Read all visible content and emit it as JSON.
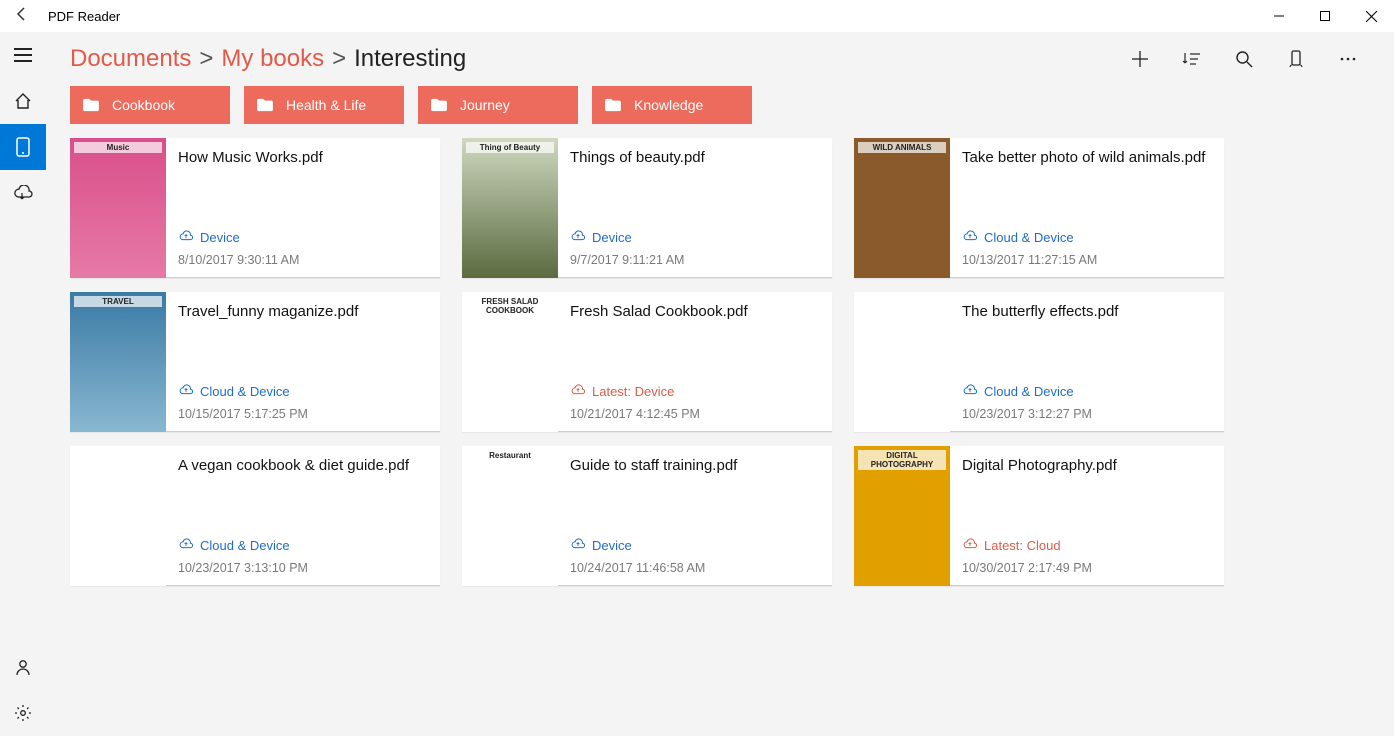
{
  "window": {
    "title": "PDF Reader"
  },
  "breadcrumb": {
    "root": "Documents",
    "mid": "My books",
    "current": "Interesting",
    "sep": ">"
  },
  "folders": [
    {
      "label": "Cookbook"
    },
    {
      "label": "Health & Life"
    },
    {
      "label": "Journey"
    },
    {
      "label": "Knowledge"
    }
  ],
  "storageLabels": {
    "device": "Device",
    "cloudDevice": "Cloud & Device",
    "latestDevice": "Latest: Device",
    "latestCloud": "Latest: Cloud"
  },
  "files": [
    {
      "name": "How Music Works.pdf",
      "storage": "device",
      "timestamp": "8/10/2017 9:30:11 AM",
      "thumbClass": "ph-music",
      "thumbTitle": "Music"
    },
    {
      "name": "Things of beauty.pdf",
      "storage": "device",
      "timestamp": "9/7/2017 9:11:21 AM",
      "thumbClass": "ph-beauty",
      "thumbTitle": "Thing of Beauty"
    },
    {
      "name": "Take better photo of wild animals.pdf",
      "storage": "cloudDevice",
      "timestamp": "10/13/2017 11:27:15 AM",
      "thumbClass": "ph-wild",
      "thumbTitle": "WILD ANIMALS"
    },
    {
      "name": "Travel_funny maganize.pdf",
      "storage": "cloudDevice",
      "timestamp": "10/15/2017 5:17:25 PM",
      "thumbClass": "ph-travel",
      "thumbTitle": "TRAVEL"
    },
    {
      "name": "Fresh Salad Cookbook.pdf",
      "storage": "latestDevice",
      "timestamp": "10/21/2017 4:12:45 PM",
      "thumbClass": "ph-salad",
      "thumbTitle": "FRESH SALAD COOKBOOK"
    },
    {
      "name": "The butterfly effects.pdf",
      "storage": "cloudDevice",
      "timestamp": "10/23/2017 3:12:27 PM",
      "thumbClass": "ph-butterfly",
      "thumbTitle": ""
    },
    {
      "name": "A vegan cookbook & diet guide.pdf",
      "storage": "cloudDevice",
      "timestamp": "10/23/2017 3:13:10 PM",
      "thumbClass": "ph-vegan",
      "thumbTitle": ""
    },
    {
      "name": "Guide to staff training.pdf",
      "storage": "device",
      "timestamp": "10/24/2017 11:46:58 AM",
      "thumbClass": "ph-restaurant",
      "thumbTitle": "Restaurant"
    },
    {
      "name": "Digital Photography.pdf",
      "storage": "latestCloud",
      "timestamp": "10/30/2017 2:17:49 PM",
      "thumbClass": "ph-photo",
      "thumbTitle": "DIGITAL PHOTOGRAPHY"
    }
  ]
}
